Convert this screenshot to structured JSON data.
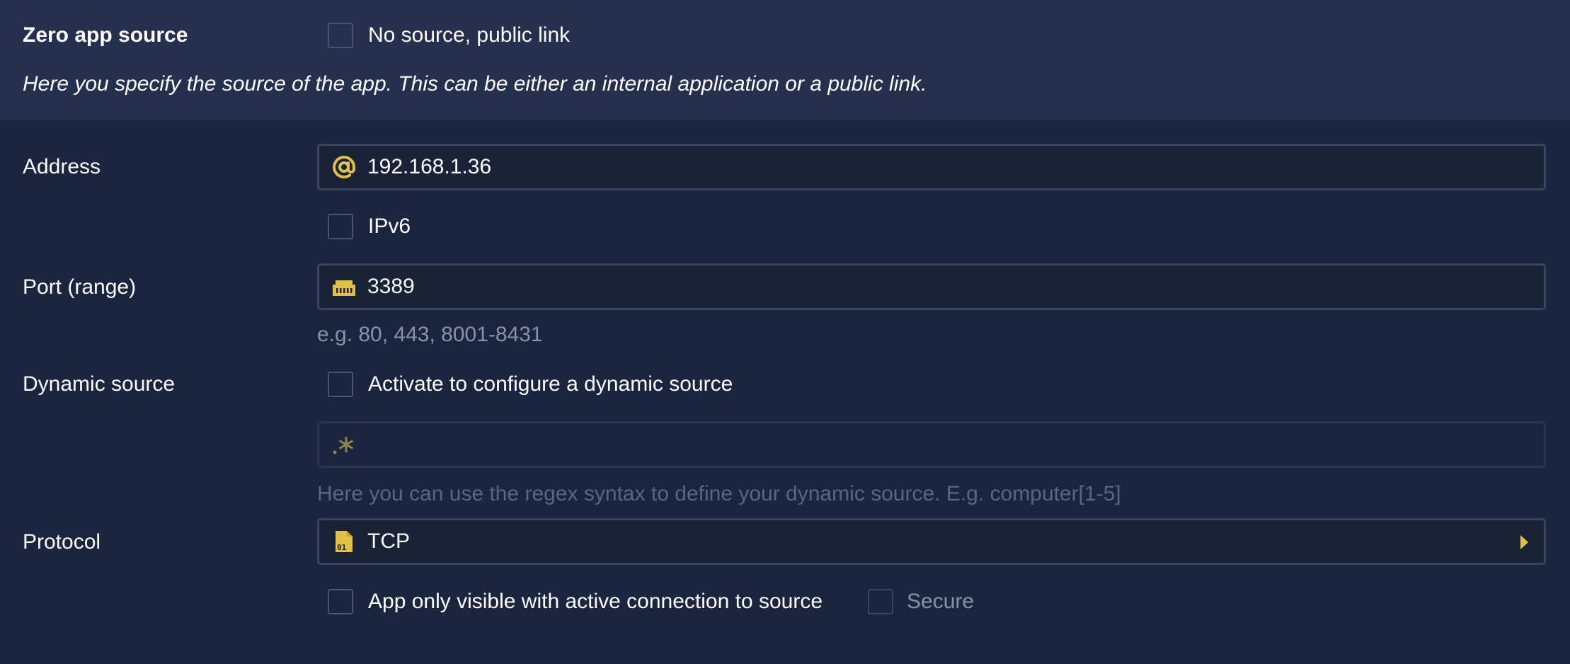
{
  "header": {
    "title": "Zero app source",
    "no_source_label": "No source, public link",
    "description": "Here you specify the source of the app. This can be either an internal application or a public link."
  },
  "address": {
    "label": "Address",
    "value": "192.168.1.36",
    "icon": "at-icon",
    "ipv6_label": "IPv6"
  },
  "port": {
    "label": "Port (range)",
    "value": "3389",
    "icon": "ethernet-port-icon",
    "hint": "e.g. 80, 443, 8001-8431"
  },
  "dynamic_source": {
    "label": "Dynamic source",
    "checkbox_label": "Activate to configure a dynamic source",
    "regex_icon": "regex-icon",
    "hint": "Here you can use the regex syntax to define your dynamic source. E.g. computer[1-5]"
  },
  "protocol": {
    "label": "Protocol",
    "value": "TCP",
    "icon": "binary-file-icon",
    "visible_label": "App only visible with active connection to source",
    "secure_label": "Secure"
  },
  "colors": {
    "background": "#1c2540",
    "header_background": "#252f4e",
    "accent": "#e2c046",
    "muted_text": "#8b92a6"
  }
}
